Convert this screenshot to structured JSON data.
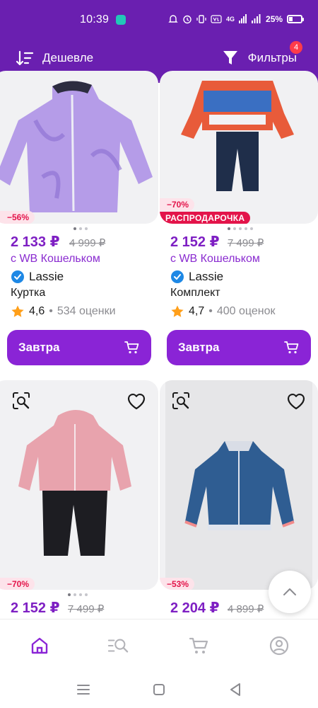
{
  "status_bar": {
    "time": "10:39",
    "icons": [
      "notification-bell-icon",
      "alarm-icon",
      "vibrate-icon",
      "volte-icon",
      "4g-signal-icon",
      "signal-icon"
    ],
    "net_label": "4G",
    "battery": "25%"
  },
  "toolbar": {
    "sort_label": "Дешевле",
    "filter_label": "Фильтры",
    "filter_count": "4"
  },
  "products": [
    {
      "discount": "−56%",
      "price": "2 133 ₽",
      "old_price": "4 999 ₽",
      "wallet": "с WB Кошельком",
      "brand": "Lassie",
      "name": "Куртка",
      "rating": "4,6",
      "reviews": "534 оценки",
      "button": "Завтра"
    },
    {
      "discount": "−70%",
      "sale_tag": "РАСПРОДАРОЧКА",
      "price": "2 152 ₽",
      "old_price": "7 499 ₽",
      "wallet": "с WB Кошельком",
      "brand": "Lassie",
      "name": "Комплект",
      "rating": "4,7",
      "reviews": "400 оценок",
      "button": "Завтра"
    },
    {
      "discount": "−70%",
      "price": "2 152 ₽",
      "old_price": "7 499 ₽"
    },
    {
      "discount": "−53%",
      "price": "2 204 ₽",
      "old_price": "4 899 ₽"
    }
  ],
  "bottom_nav": [
    "home-icon",
    "catalog-search-icon",
    "cart-icon",
    "profile-icon"
  ],
  "colors": {
    "brand_purple": "#6a1fb0",
    "button_purple": "#8a24d6",
    "price_purple": "#7e1fc3",
    "discount_red": "#e3144a"
  }
}
